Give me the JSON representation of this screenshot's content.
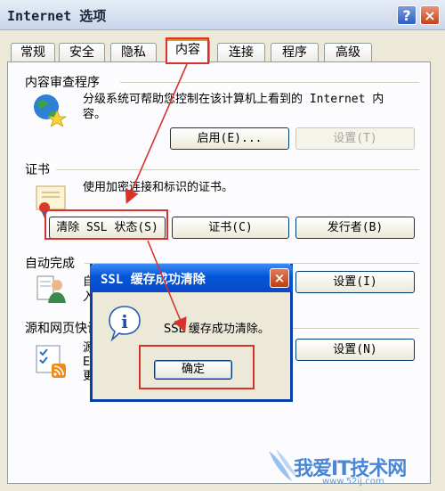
{
  "window": {
    "title": "Internet 选项",
    "help_label": "?",
    "close_label": "×"
  },
  "tabs": [
    {
      "label": "常规"
    },
    {
      "label": "安全"
    },
    {
      "label": "隐私"
    },
    {
      "label": "内容",
      "active": true
    },
    {
      "label": "连接"
    },
    {
      "label": "程序"
    },
    {
      "label": "高级"
    }
  ],
  "content_advisor": {
    "heading": "内容审查程序",
    "desc_line1": "分级系统可帮助您控制在该计算机上看到的 Internet 内",
    "desc_line2": "容。",
    "enable_button": "启用(E)...",
    "settings_button": "设置(T)"
  },
  "certificates": {
    "heading": "证书",
    "desc": "使用加密连接和标识的证书。",
    "clear_ssl_button": "清除 SSL 状态(S)",
    "certificates_button": "证书(C)",
    "publishers_button": "发行者(B)"
  },
  "autocomplete": {
    "heading": "自动完成",
    "desc_partial_1": "自",
    "desc_partial_2": "入",
    "settings_button": "设置(I)"
  },
  "feeds": {
    "heading": "源和网页快讯",
    "desc_partial_1": "源",
    "desc_partial_2": "E",
    "desc_partial_3": "更",
    "settings_button": "设置(N)"
  },
  "dialog": {
    "title": "SSL 缓存成功清除",
    "close_label": "×",
    "icon_label": "i",
    "message": "SSL 缓存成功清除。",
    "ok_button": "确定"
  },
  "watermark": {
    "text": "我爱IT技术网",
    "url": "www.52ij.com"
  },
  "colors": {
    "highlight": "#d9322b",
    "dialog_title": "#0355d8",
    "tab_active_accent": "#e68b2c"
  }
}
